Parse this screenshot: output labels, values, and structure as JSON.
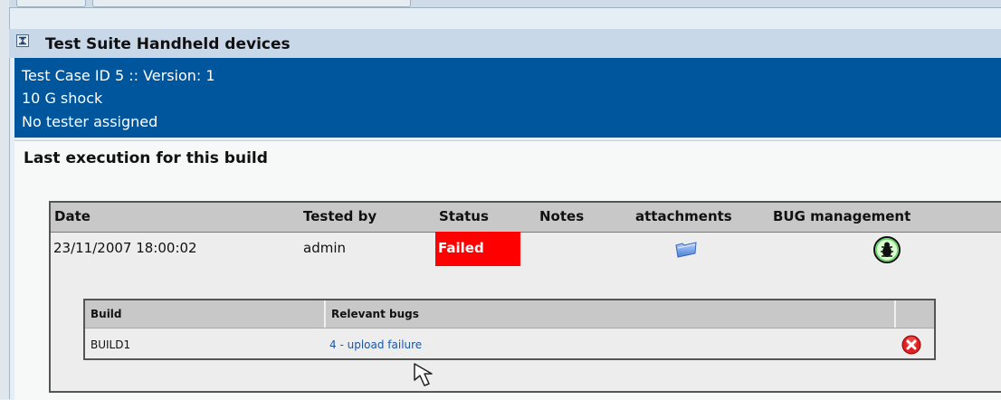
{
  "suite": {
    "title": "Test Suite Handheld devices",
    "icon": "collapse-icon"
  },
  "test_case": {
    "id_version": "Test Case ID 5 :: Version: 1",
    "name": "10 G shock",
    "tester": "No tester assigned"
  },
  "section_title": "Last execution for this build",
  "execution_table": {
    "headers": {
      "date": "Date",
      "tested_by": "Tested by",
      "status": "Status",
      "notes": "Notes",
      "attachments": "attachments",
      "bug_management": "BUG management"
    },
    "row": {
      "date": "23/11/2007 18:00:02",
      "tested_by": "admin",
      "status": "Failed",
      "notes": "",
      "attachments_icon": "folder-icon",
      "bug_icon": "bug-icon"
    }
  },
  "bugs_table": {
    "headers": {
      "build": "Build",
      "relevant_bugs": "Relevant bugs"
    },
    "rows": [
      {
        "build": "BUILD1",
        "bug": "4 - upload failure",
        "action_icon": "delete-icon"
      }
    ]
  },
  "colors": {
    "case_header_bg": "#00569c",
    "status_failed_bg": "#ff0000",
    "link": "#1a56a5"
  }
}
